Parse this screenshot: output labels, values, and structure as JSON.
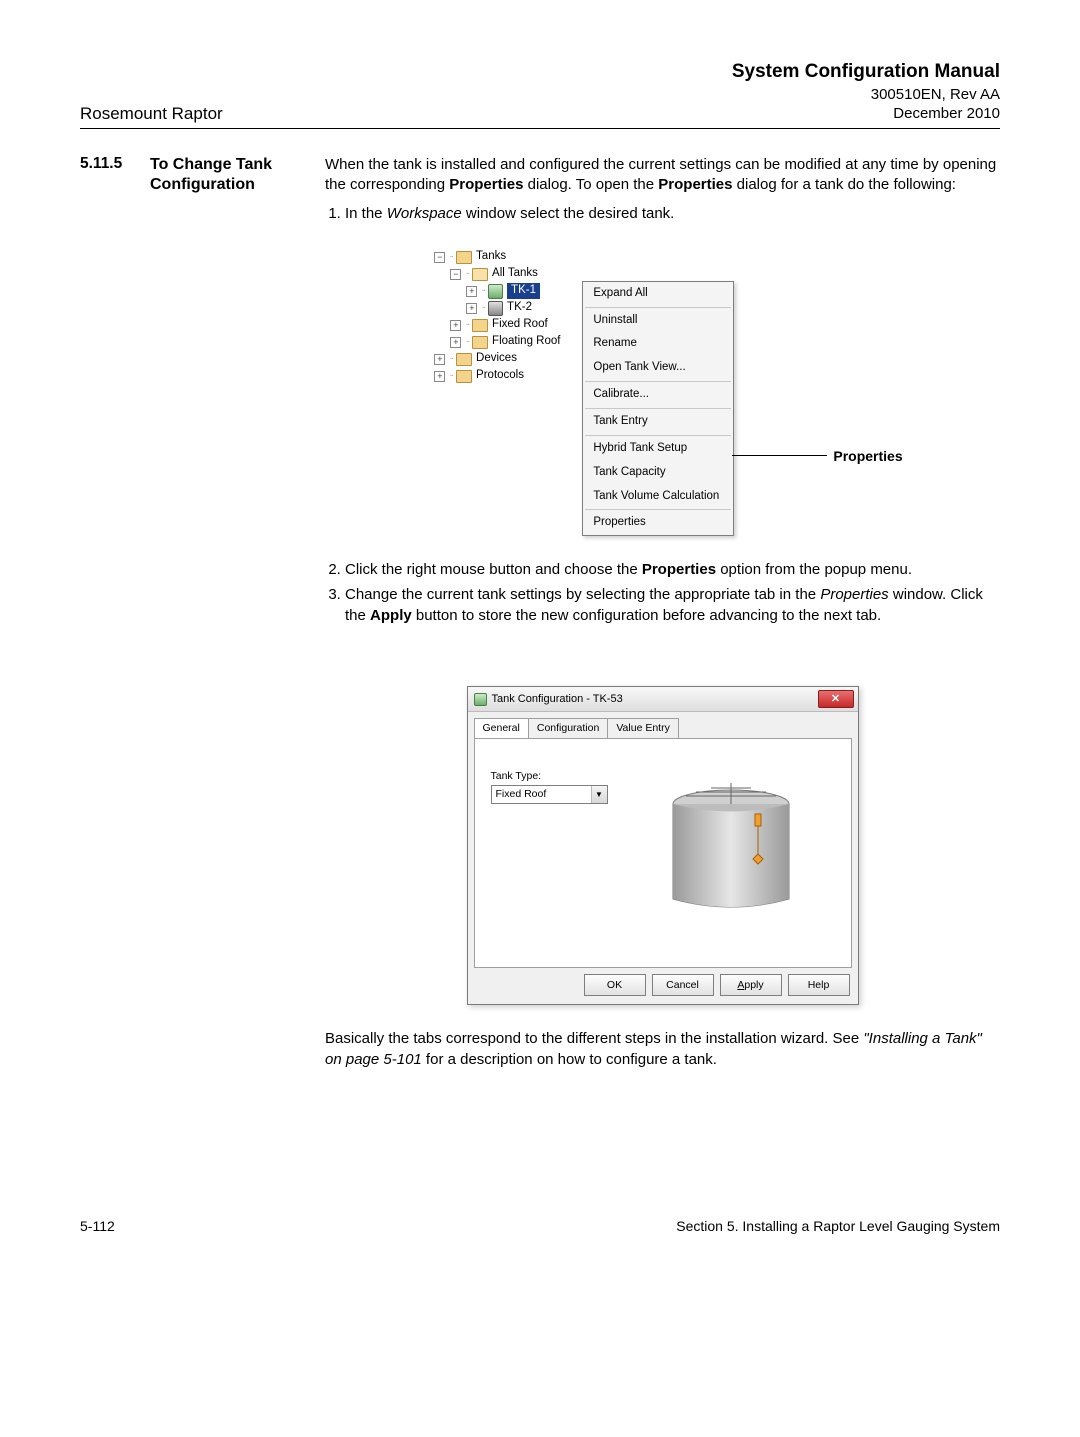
{
  "header": {
    "product": "Rosemount Raptor",
    "manual": "System Configuration Manual",
    "docnum": "300510EN, Rev AA",
    "date": "December 2010"
  },
  "section": {
    "number": "5.11.5",
    "title": "To Change Tank Configuration",
    "intro_parts": [
      "When the tank is installed and configured the current settings can be modified at any time by opening the corresponding ",
      "Properties",
      " dialog. To open the ",
      "Properties",
      " dialog for a tank do the following:"
    ],
    "steps": {
      "1_parts": [
        "In the ",
        "Workspace",
        " window select the desired tank."
      ],
      "2_parts": [
        "Click the right mouse button and choose the ",
        "Properties",
        " option from the popup menu."
      ],
      "3_parts": [
        "Change the current tank settings by selecting the appropriate tab in the ",
        "Properties",
        " window. Click the ",
        "Apply",
        " button to store the new configuration before advancing to the next tab."
      ]
    }
  },
  "tree": {
    "tanks": "Tanks",
    "all_tanks": "All Tanks",
    "tk1": "TK-1",
    "tk2": "TK-2",
    "fixed": "Fixed Roof",
    "floating": "Floating Roof",
    "devices": "Devices",
    "protocols": "Protocols"
  },
  "ctxmenu": {
    "expand": "Expand All",
    "uninstall": "Uninstall",
    "rename": "Rename",
    "opentankview": "Open Tank View...",
    "calibrate": "Calibrate...",
    "tankentry": "Tank Entry",
    "hybrid": "Hybrid Tank Setup",
    "capacity": "Tank Capacity",
    "volume": "Tank Volume Calculation",
    "properties": "Properties"
  },
  "callout_label": "Properties",
  "dialog": {
    "title": "Tank Configuration - TK-53",
    "tabs": [
      "General",
      "Configuration",
      "Value Entry"
    ],
    "tank_type_label": "Tank Type:",
    "tank_type_value": "Fixed Roof",
    "buttons": {
      "ok": "OK",
      "cancel": "Cancel",
      "apply_u": "A",
      "apply_rest": "pply",
      "help": "Help"
    }
  },
  "closing_parts": [
    "Basically the tabs correspond to the different steps in the installation wizard. See ",
    "\"Installing a Tank\" on page 5-101",
    " for a description on how to configure a tank."
  ],
  "footer": {
    "pagenum": "5-112",
    "section": "Section 5. Installing a Raptor Level Gauging System"
  }
}
